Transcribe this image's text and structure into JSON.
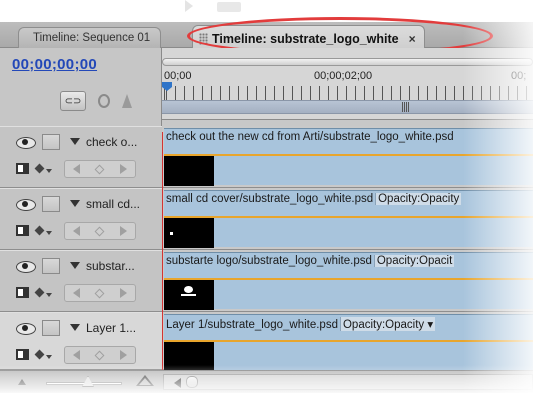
{
  "tabs": [
    {
      "label": "Timeline: Sequence 01",
      "active": false
    },
    {
      "label": "Timeline: substrate_logo_white",
      "active": true,
      "close_glyph": "×"
    }
  ],
  "timecode": "00;00;00;00",
  "ruler": {
    "labels": [
      "00;00",
      "00;00;02;00",
      "00;"
    ]
  },
  "tracks": [
    {
      "name": "check o...",
      "clip": "check out the new cd from Arti/substrate_logo_white.psd",
      "opacity": ""
    },
    {
      "name": "small cd...",
      "clip": "small cd cover/substrate_logo_white.psd",
      "opacity": "Opacity:Opacity"
    },
    {
      "name": "substar...",
      "clip": "substarte logo/substrate_logo_white.psd",
      "opacity": "Opacity:Opacit"
    },
    {
      "name": "Layer 1...",
      "clip": "Layer 1/substrate_logo_white.psd",
      "opacity": "Opacity:Opacity ▾"
    }
  ],
  "colors": {
    "highlight": "#e23c3c",
    "timecode": "#2348b8",
    "clip": "#a8c4dc",
    "keyframe_line": "#e8a52c",
    "playhead": "#d33434"
  },
  "icons": [
    "grip-icon",
    "close-icon",
    "snap-icon",
    "marker-icon",
    "keyframe-icon",
    "eye-icon",
    "collapse-icon",
    "display-icon",
    "prev-key-icon",
    "add-key-icon",
    "next-key-icon",
    "zoom-out-icon",
    "zoom-in-icon",
    "scroll-left-icon"
  ]
}
